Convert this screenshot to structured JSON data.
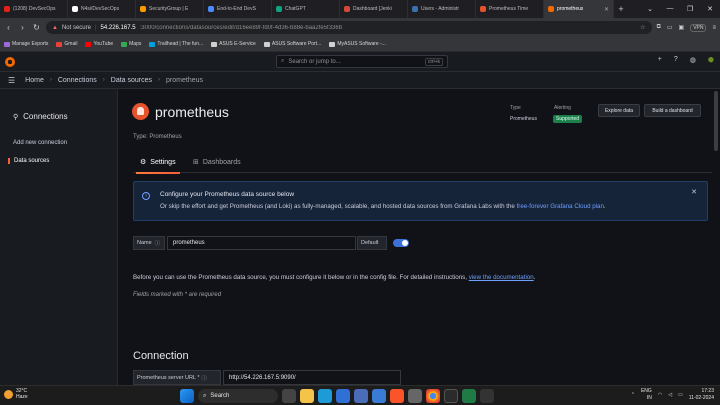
{
  "browser": {
    "tabs": [
      {
        "title": "(1208) DevSecOps",
        "color": "#e62117"
      },
      {
        "title": "N4si/DevSecOps",
        "color": "#ffffff"
      },
      {
        "title": "SecurityGroup | E",
        "color": "#ff9900"
      },
      {
        "title": "End-to-End DevS",
        "color": "#4a8cff"
      },
      {
        "title": "ChatGPT",
        "color": "#10a37f"
      },
      {
        "title": "Dashboard [Jenki",
        "color": "#d24939"
      },
      {
        "title": "Users - Administr",
        "color": "#3a6fb0"
      },
      {
        "title": "Prometheus Time",
        "color": "#e6522c"
      },
      {
        "title": "prometheus",
        "color": "#f46800"
      }
    ],
    "active_tab_index": 8,
    "new_tab": "+",
    "window_controls": [
      "⌄",
      "—",
      "❐",
      "✕"
    ],
    "address": {
      "not_secure": "Not secure",
      "host": "54.226.167.5",
      "path": ":3000/connections/datasources/edit/d16ee89f-fd0f-4d36-b88e-baa2fe5f336b"
    },
    "vpn": "VPN",
    "bookmarks": [
      {
        "label": "Manage Exports",
        "color": "#9c6ad8"
      },
      {
        "label": "Gmail",
        "color": "#ea4335"
      },
      {
        "label": "YouTube",
        "color": "#ff0000"
      },
      {
        "label": "Maps",
        "color": "#34a853"
      },
      {
        "label": "Trailhead | The fun...",
        "color": "#00a1e0"
      },
      {
        "label": "ASUS E-Service",
        "color": "#d0d0d0"
      },
      {
        "label": "ASUS Software Port...",
        "color": "#d0d0d0"
      },
      {
        "label": "MyASUS Software -...",
        "color": "#d0d0d0"
      }
    ]
  },
  "grafana": {
    "search_placeholder": "Search or jump to...",
    "search_shortcut": "ctrl+k",
    "breadcrumb": [
      "Home",
      "Connections",
      "Data sources",
      "prometheus"
    ],
    "sidebar": {
      "title": "Connections",
      "items": [
        {
          "label": "Add new connection",
          "active": false
        },
        {
          "label": "Data sources",
          "active": true
        }
      ]
    },
    "datasource": {
      "name": "prometheus",
      "type_line": "Type: Prometheus",
      "meta_type_label": "Type",
      "meta_type_value": "Prometheus",
      "meta_alerting_label": "Alerting",
      "meta_alerting_value": "Supported",
      "explore_button": "Explore data",
      "dashboard_button": "Build a dashboard"
    },
    "tabs": [
      {
        "label": "Settings",
        "active": true
      },
      {
        "label": "Dashboards",
        "active": false
      }
    ],
    "alert": {
      "title": "Configure your Prometheus data source below",
      "body": "Or skip the effort and get Prometheus (and Loki) as fully-managed, scalable, and hosted data sources from Grafana Labs with the ",
      "link": "free-forever Grafana Cloud plan",
      "body_end": "."
    },
    "name_field": {
      "label": "Name",
      "value": "prometheus"
    },
    "default_field": {
      "label": "Default",
      "enabled": true
    },
    "intro": {
      "text": "Before you can use the Prometheus data source, you must configure it below or in the config file. For detailed instructions, ",
      "link": "view the documentation",
      "end": "."
    },
    "required_note": "Fields marked with * are required",
    "connection": {
      "heading": "Connection",
      "url_label": "Prometheus server URL *",
      "url_value": "http://54.226.167.5:9090/"
    }
  },
  "taskbar": {
    "temp": "32°C",
    "weather": "Haze",
    "search": "Search",
    "lang1": "ENG",
    "lang2": "IN",
    "time": "17:23",
    "date": "11-02-2024"
  }
}
